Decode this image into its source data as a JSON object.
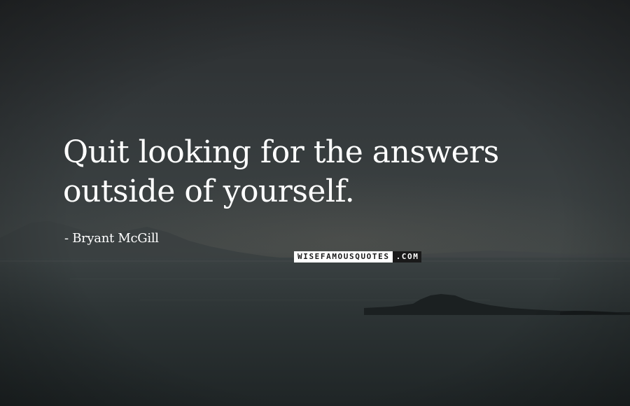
{
  "quote": {
    "text": "Quit looking for the answers outside of yourself.",
    "author": "- Bryant McGill"
  },
  "watermark": {
    "brand": "WISEFAMOUSQUOTES",
    "suffix": ".COM"
  },
  "colors": {
    "text": "#ffffff",
    "sky": "#34393b",
    "sea": "#2c3334"
  }
}
